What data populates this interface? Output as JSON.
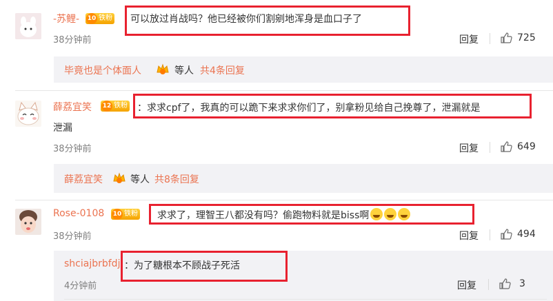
{
  "comments": [
    {
      "username": "-苏鲤-",
      "badge_level": "10",
      "badge_text": "铁粉",
      "text": "可以放过肖战吗？他已经被你们割剜地浑身是血口子了",
      "time": "38分钟前",
      "reply_label": "回复",
      "likes": "725",
      "sub_summary": {
        "name": "毕竟也是个体面人",
        "middle": "等人",
        "count_text": "共4条回复"
      }
    },
    {
      "username": "薛荔宜笑",
      "badge_level": "12",
      "badge_text": "铁粉",
      "text_line1": "：求求cpf了，我真的可以跪下来求求你们了，别拿粉见给自己挽尊了，泄漏就是",
      "text_line2": "泄漏",
      "time": "38分钟前",
      "reply_label": "回复",
      "likes": "649",
      "sub_summary": {
        "name": "薛荔宜笑",
        "middle": "等人",
        "count_text": "共8条回复"
      }
    },
    {
      "username": "Rose-0108",
      "badge_level": "10",
      "badge_text": "铁粉",
      "text": "：求求了，理智王八都没有吗？偷跑物料就是biss啊",
      "time": "38分钟前",
      "reply_label": "回复",
      "likes": "494",
      "reply": {
        "username": "shciajbrbfdj",
        "text": "：为了糖根本不顾战子死活",
        "time": "4分钟前",
        "reply_label": "回复",
        "likes": "3"
      }
    }
  ],
  "colors": {
    "username": "#eb7350",
    "highlight": "#e8212f",
    "badge": "#f5a300"
  },
  "icons": [
    "thumbs-up-icon",
    "crown-icon",
    "crying-emoji-icon"
  ]
}
